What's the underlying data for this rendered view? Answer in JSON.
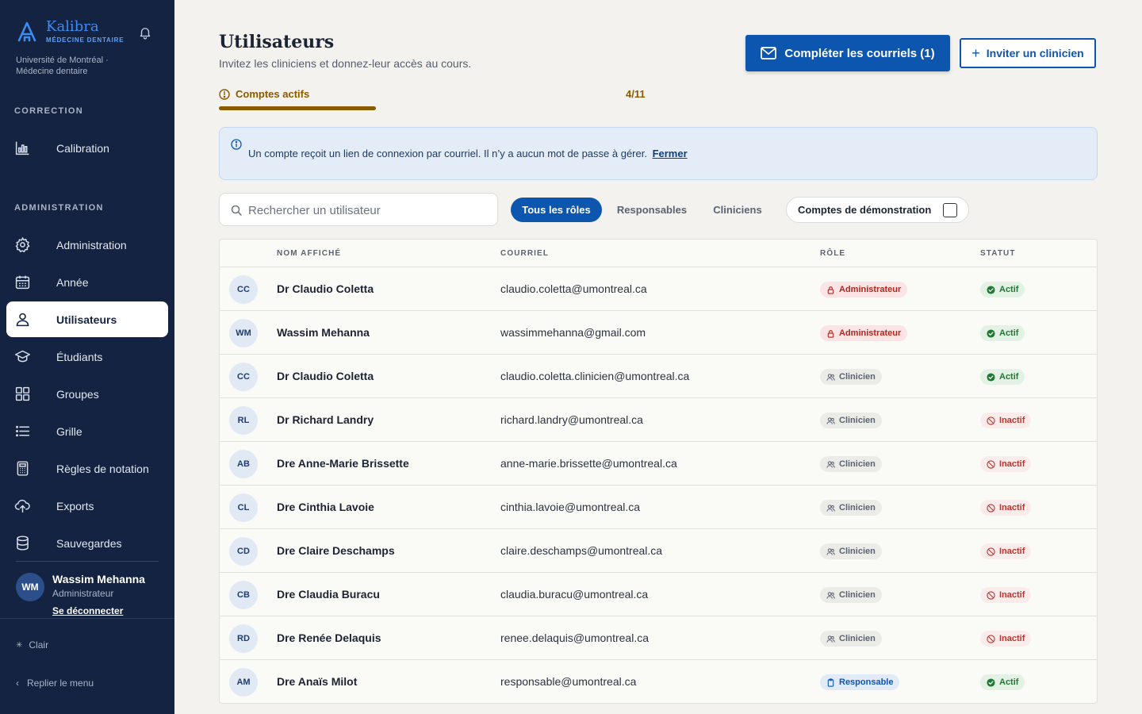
{
  "brand": {
    "name": "Kalibra",
    "subtitle": "MÉDECINE DENTAIRE",
    "institution": "Université de Montréal · Médecine dentaire"
  },
  "sidebar": {
    "section_correction": "CORRECTION",
    "section_admin": "ADMINISTRATION",
    "items": [
      {
        "label": "Calibration",
        "icon": "bar-chart-icon"
      },
      {
        "label": "Administration",
        "icon": "gear-icon"
      },
      {
        "label": "Année",
        "icon": "calendar-icon"
      },
      {
        "label": "Utilisateurs",
        "icon": "user-icon",
        "active": true
      },
      {
        "label": "Étudiants",
        "icon": "graduation-cap-icon"
      },
      {
        "label": "Groupes",
        "icon": "grid-icon"
      },
      {
        "label": "Grille",
        "icon": "list-icon"
      },
      {
        "label": "Règles de notation",
        "icon": "calculator-icon"
      },
      {
        "label": "Exports",
        "icon": "cloud-upload-icon"
      },
      {
        "label": "Sauvegardes",
        "icon": "database-icon"
      }
    ],
    "user": {
      "initials": "WM",
      "name": "Wassim Mehanna",
      "role": "Administrateur",
      "logout": "Se déconnecter"
    },
    "theme": "Clair",
    "collapse": "Replier le menu"
  },
  "header": {
    "title": "Utilisateurs",
    "subtitle": "Invitez les cliniciens et donnez-leur accès au cours.",
    "primary_button": "Compléter les courriels (1)",
    "secondary_button": "Inviter un clinicien"
  },
  "progress": {
    "label": "Comptes actifs",
    "count": "4/11",
    "fraction": 0.3636
  },
  "banner": {
    "text": "Un compte reçoit un lien de connexion par courriel. Il n’y a aucun mot de passe à gérer.",
    "close": "Fermer"
  },
  "search": {
    "placeholder": "Rechercher un utilisateur",
    "value": ""
  },
  "filters": {
    "all": "Tous les rôles",
    "responsables": "Responsables",
    "cliniciens": "Cliniciens",
    "demo": "Comptes de démonstration",
    "demo_checked": false
  },
  "table": {
    "headers": {
      "name": "NOM AFFICHÉ",
      "email": "COURRIEL",
      "role": "RÔLE",
      "status": "STATUT"
    },
    "rows": [
      {
        "initials": "CC",
        "name": "Dr Claudio Coletta",
        "email": "claudio.coletta@umontreal.ca",
        "role": "Administrateur",
        "role_kind": "admin",
        "status": "Actif",
        "status_kind": "actif"
      },
      {
        "initials": "WM",
        "name": "Wassim Mehanna",
        "email": "wassimmehanna@gmail.com",
        "role": "Administrateur",
        "role_kind": "admin",
        "status": "Actif",
        "status_kind": "actif"
      },
      {
        "initials": "CC",
        "name": "Dr Claudio Coletta",
        "email": "claudio.coletta.clinicien@umontreal.ca",
        "role": "Clinicien",
        "role_kind": "clin",
        "status": "Actif",
        "status_kind": "actif"
      },
      {
        "initials": "RL",
        "name": "Dr Richard Landry",
        "email": "richard.landry@umontreal.ca",
        "role": "Clinicien",
        "role_kind": "clin",
        "status": "Inactif",
        "status_kind": "inactif"
      },
      {
        "initials": "AB",
        "name": "Dre Anne-Marie Brissette",
        "email": "anne-marie.brissette@umontreal.ca",
        "role": "Clinicien",
        "role_kind": "clin",
        "status": "Inactif",
        "status_kind": "inactif"
      },
      {
        "initials": "CL",
        "name": "Dre Cinthia Lavoie",
        "email": "cinthia.lavoie@umontreal.ca",
        "role": "Clinicien",
        "role_kind": "clin",
        "status": "Inactif",
        "status_kind": "inactif"
      },
      {
        "initials": "CD",
        "name": "Dre Claire Deschamps",
        "email": "claire.deschamps@umontreal.ca",
        "role": "Clinicien",
        "role_kind": "clin",
        "status": "Inactif",
        "status_kind": "inactif"
      },
      {
        "initials": "CB",
        "name": "Dre Claudia Buracu",
        "email": "claudia.buracu@umontreal.ca",
        "role": "Clinicien",
        "role_kind": "clin",
        "status": "Inactif",
        "status_kind": "inactif"
      },
      {
        "initials": "RD",
        "name": "Dre Renée Delaquis",
        "email": "renee.delaquis@umontreal.ca",
        "role": "Clinicien",
        "role_kind": "clin",
        "status": "Inactif",
        "status_kind": "inactif"
      },
      {
        "initials": "AM",
        "name": "Dre Anaïs Milot",
        "email": "responsable@umontreal.ca",
        "role": "Responsable",
        "role_kind": "resp",
        "status": "Actif",
        "status_kind": "actif"
      }
    ]
  },
  "colors": {
    "sidebar": "#142341",
    "primary": "#0d56b0",
    "progress": "#8a5a00",
    "admin_badge": "#b3261e",
    "active_status": "#1e7a33",
    "inactive_status": "#c0322b"
  }
}
